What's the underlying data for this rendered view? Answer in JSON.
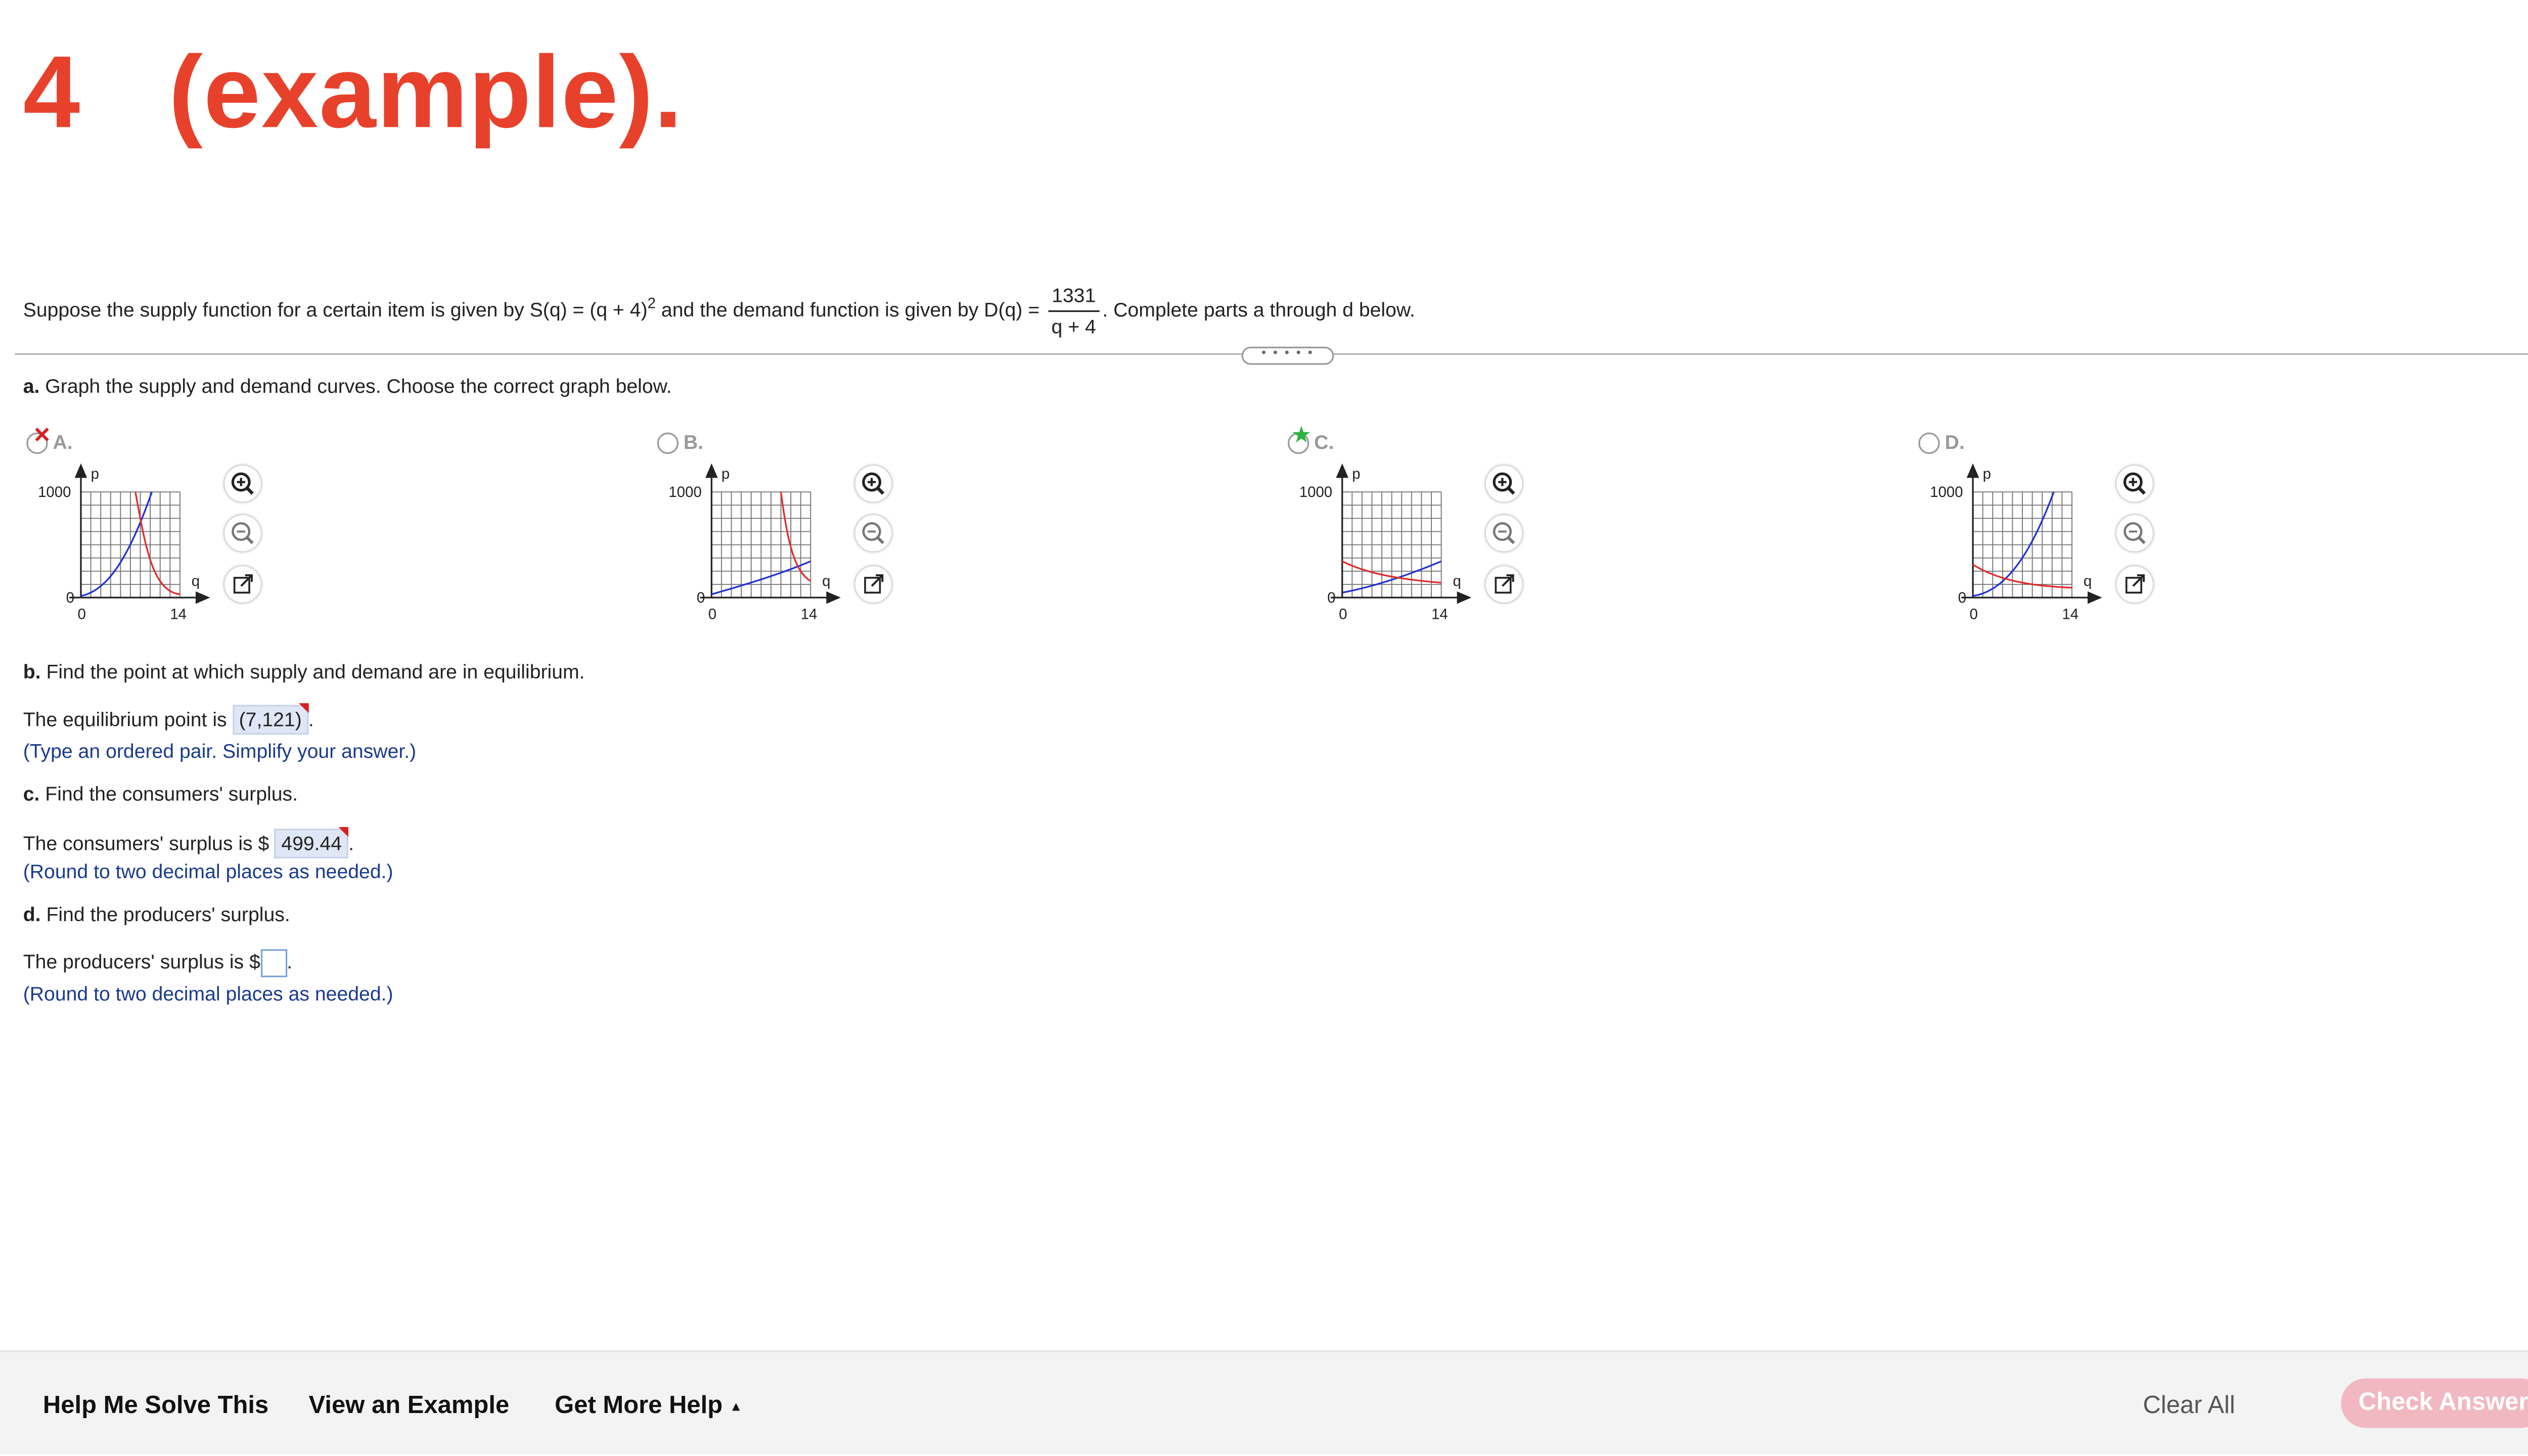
{
  "title": "4   (example).",
  "problem": {
    "text_before": "Suppose the supply function for a certain item is given by S(q) = (q + 4)",
    "exp": "2",
    "text_mid": " and the demand function is given by D(q) = ",
    "frac_num": "1331",
    "frac_den": "q + 4",
    "text_after": ". Complete parts a through d below."
  },
  "divider_handle": "• • • • •",
  "part_a": {
    "label": "a.",
    "text": " Graph the supply and demand curves. Choose the correct graph below."
  },
  "options": [
    {
      "letter": "A.",
      "status": "incorrect-selected",
      "y_label": "1000",
      "y_zero": "0",
      "x_zero": "0",
      "x_label": "14",
      "p_label": "p",
      "q_label": "q"
    },
    {
      "letter": "B.",
      "status": "unselected",
      "y_label": "1000",
      "y_zero": "0",
      "x_zero": "0",
      "x_label": "14",
      "p_label": "p",
      "q_label": "q"
    },
    {
      "letter": "C.",
      "status": "correct",
      "y_label": "1000",
      "y_zero": "0",
      "x_zero": "0",
      "x_label": "14",
      "p_label": "p",
      "q_label": "q"
    },
    {
      "letter": "D.",
      "status": "unselected",
      "y_label": "1000",
      "y_zero": "0",
      "x_zero": "0",
      "x_label": "14",
      "p_label": "p",
      "q_label": "q"
    }
  ],
  "part_b": {
    "label": "b.",
    "text": " Find the point at which supply and demand are in equilibrium.",
    "answer_prefix": "The equilibrium point is ",
    "answer": "(7,121)",
    "answer_suffix": ".",
    "hint": "(Type an ordered pair. Simplify your answer.)"
  },
  "part_c": {
    "label": "c.",
    "text": " Find the consumers' surplus.",
    "answer_prefix": "The consumers' surplus is $ ",
    "answer": "499.44",
    "answer_suffix": ".",
    "hint": "(Round to two decimal places as needed.)"
  },
  "part_d": {
    "label": "d.",
    "text": " Find the producers' surplus.",
    "answer_prefix": "The producers' surplus is $",
    "answer_suffix": ".",
    "hint": "(Round to two decimal places as needed.)"
  },
  "footer": {
    "help_me_solve": "Help Me Solve This",
    "view_example": "View an Example",
    "get_more_help": "Get More Help",
    "get_more_help_arrow": "▲",
    "clear_all": "Clear All",
    "check_answer": "Check Answer"
  },
  "colors": {
    "title": "#e8412b",
    "supply": "#1f2fd6",
    "demand": "#e02b2b",
    "hint": "#1a3a8c",
    "check_button": "#f1b8c2"
  },
  "icons": [
    "zoom-in-icon",
    "zoom-out-icon",
    "popout-icon",
    "radio-icon",
    "incorrect-x-icon",
    "correct-star-icon"
  ]
}
